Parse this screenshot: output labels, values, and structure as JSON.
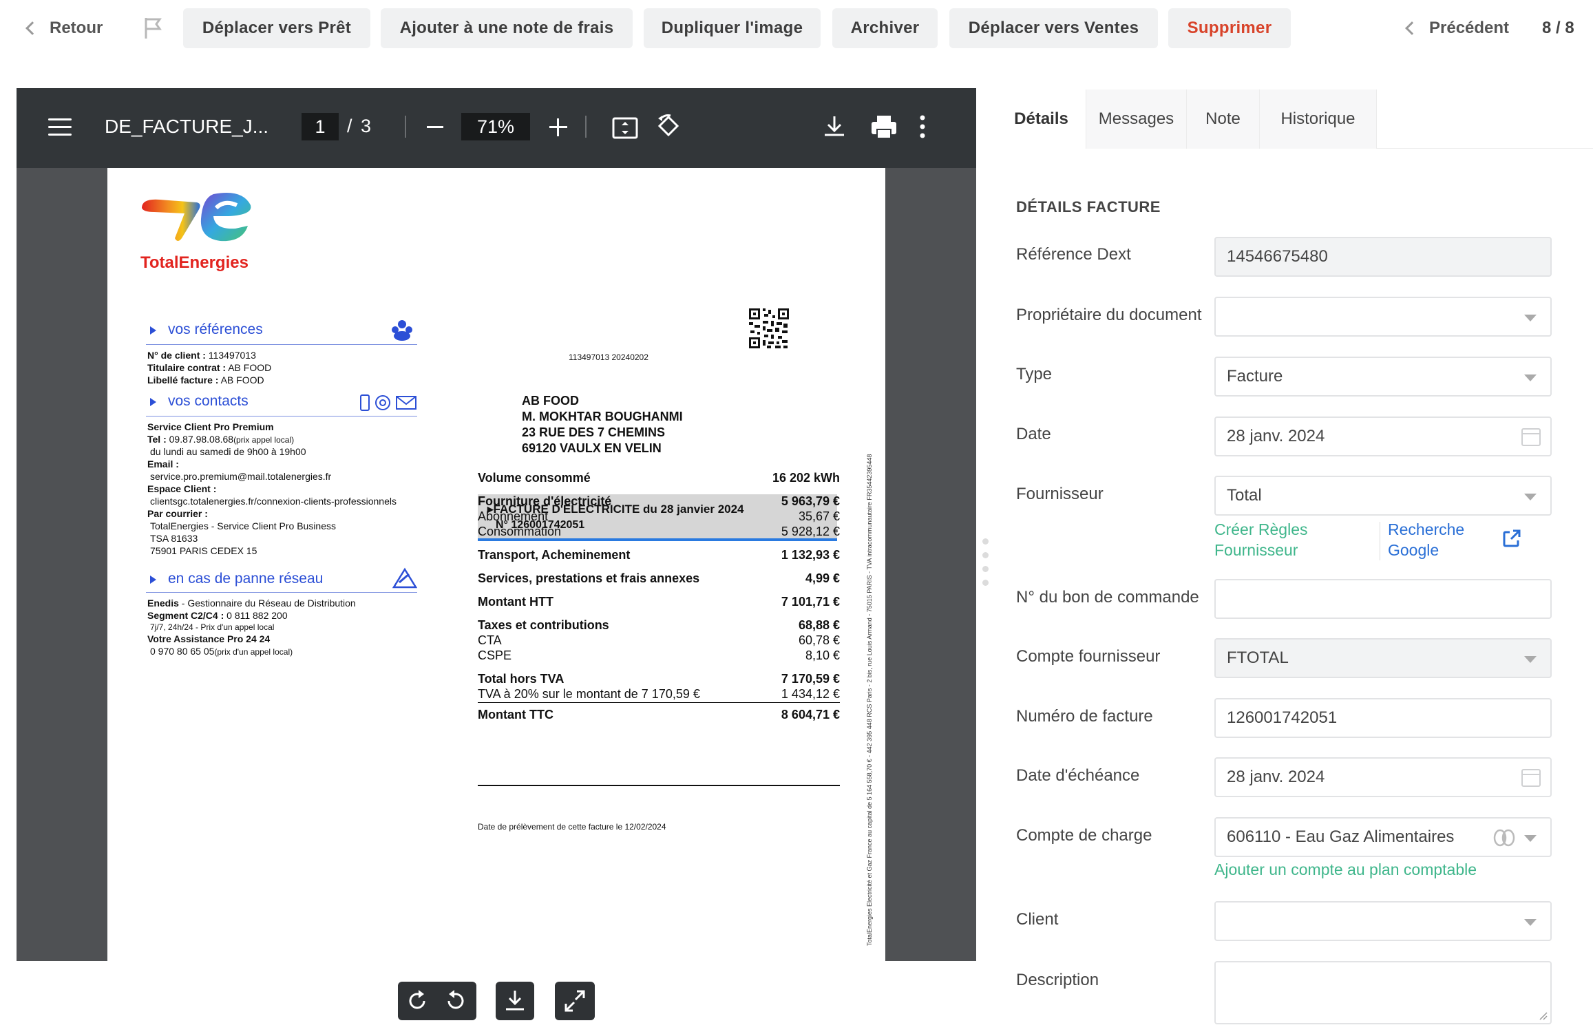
{
  "topbar": {
    "back_label": "Retour",
    "actions": [
      {
        "label": "Déplacer vers Prêt"
      },
      {
        "label": "Ajouter à une note de frais"
      },
      {
        "label": "Dupliquer l'image"
      },
      {
        "label": "Archiver"
      },
      {
        "label": "Déplacer vers Ventes"
      },
      {
        "label": "Supprimer"
      }
    ],
    "prev_label": "Précédent",
    "page_counter": "8 / 8"
  },
  "viewer": {
    "file_title": "DE_FACTURE_J...",
    "current_page": "1",
    "page_sep": "/",
    "total_pages": "3",
    "zoom": "71%"
  },
  "invoice": {
    "brand": "TotalEnergies",
    "refs_title": "vos références",
    "client_no_label": "N° de client :",
    "client_no": "113497013",
    "holder_label": "Titulaire contrat :",
    "holder": "AB FOOD",
    "bill_label_label": "Libellé facture :",
    "bill_label": "AB FOOD",
    "contacts_title": "vos contacts",
    "service_name": "Service Client Pro Premium",
    "tel_label": "Tel :",
    "tel": "09.87.98.08.68",
    "tel_note": "(prix appel local)",
    "hours": "du lundi au samedi de 9h00 à 19h00",
    "email_label": "Email :",
    "email": "service.pro.premium@mail.totalenergies.fr",
    "space_label": "Espace Client :",
    "space_url": "clientsgc.totalenergies.fr/connexion-clients-professionnels",
    "mail_label": "Par courrier :",
    "mail_line1": "TotalEnergies - Service Client Pro Business",
    "mail_line2": "TSA 81633",
    "mail_line3": "75901 PARIS CEDEX 15",
    "outage_title": "en cas de panne réseau",
    "enedis_label": "Enedis",
    "enedis_desc": "- Gestionnaire du Réseau de Distribution",
    "segment_label": "Segment C2/C4 :",
    "segment_phone": "0 811 882 200",
    "segment_note": "7j/7, 24h/24 - Prix d'un appel local",
    "assist_label": "Votre Assistance Pro 24 24",
    "assist_phone": "0 970 80 65 05",
    "assist_note": "(prix d'un appel local)",
    "codes": "113497013   20240202",
    "addr1": "AB FOOD",
    "addr2": "M. MOKHTAR BOUGHANMI",
    "addr3": "23 RUE DES 7 CHEMINS",
    "addr4": "69120 VAULX EN VELIN",
    "bill_title": "FACTURE D'ELECTRICITE du 28 janvier 2024",
    "bill_no": "N° 126001742051",
    "lines": [
      {
        "label": "Volume consommé",
        "value": "16 202 kWh",
        "bold": true
      },
      {
        "label": "Fourniture d'électricité",
        "value": "5 963,79 €",
        "bold": true
      },
      {
        "label": "Abonnement",
        "value": "35,67 €",
        "bold": false
      },
      {
        "label": "Consommation",
        "value": "5 928,12 €",
        "bold": false
      },
      {
        "label": "Transport, Acheminement",
        "value": "1 132,93 €",
        "bold": true
      },
      {
        "label": "Services, prestations et frais annexes",
        "value": "4,99 €",
        "bold": true
      },
      {
        "label": "Montant HTT",
        "value": "7 101,71 €",
        "bold": true
      },
      {
        "label": "Taxes et contributions",
        "value": "68,88 €",
        "bold": true
      },
      {
        "label": "CTA",
        "value": "60,78 €",
        "bold": false
      },
      {
        "label": "CSPE",
        "value": "8,10 €",
        "bold": false
      },
      {
        "label": "Total hors TVA",
        "value": "7 170,59 €",
        "bold": true
      },
      {
        "label": "TVA à 20% sur le montant de 7 170,59 €",
        "value": "1 434,12 €",
        "bold": false
      },
      {
        "label": "Montant TTC",
        "value": "8 604,71 €",
        "bold": true
      }
    ],
    "debit_note": "Date de prélèvement de cette facture le 12/02/2024",
    "side_legal": "TotalEnergies Electricité et Gaz France au capital de 5 164 558,70 € - 442 395 448 RCS Paris - 2 bis, rue Louis Armand - 75015 PARIS - TVA intracommunautaire FR35442395448"
  },
  "panel": {
    "tabs": [
      {
        "label": "Détails"
      },
      {
        "label": "Messages"
      },
      {
        "label": "Note"
      },
      {
        "label": "Historique"
      }
    ],
    "section_title": "DÉTAILS FACTURE",
    "fields": {
      "ref": {
        "label": "Référence Dext",
        "value": "14546675480"
      },
      "owner": {
        "label": "Propriétaire du document",
        "value": ""
      },
      "type": {
        "label": "Type",
        "value": "Facture"
      },
      "date": {
        "label": "Date",
        "value": "28 janv. 2024"
      },
      "supplier": {
        "label": "Fournisseur",
        "value": "Total"
      },
      "po": {
        "label": "N° du bon de commande",
        "value": ""
      },
      "supplier_account": {
        "label": "Compte fournisseur",
        "value": "FTOTAL"
      },
      "invoice_no": {
        "label": "Numéro de facture",
        "value": "126001742051"
      },
      "due_date": {
        "label": "Date d'échéance",
        "value": "28 janv. 2024"
      },
      "charge_account": {
        "label": "Compte de charge",
        "value": "606110 - Eau Gaz Alimentaires"
      },
      "client": {
        "label": "Client",
        "value": ""
      },
      "description": {
        "label": "Description",
        "value": ""
      }
    },
    "links": {
      "create_rules_1": "Créer Règles",
      "create_rules_2": "Fournisseur",
      "google_1": "Recherche",
      "google_2": "Google",
      "add_account": "Ajouter un compte au plan comptable"
    }
  },
  "colors": {
    "accent_green": "#3fb68b",
    "link_blue": "#2a6fd6",
    "danger": "#d8432a",
    "viewer_toolbar": "#323639"
  }
}
